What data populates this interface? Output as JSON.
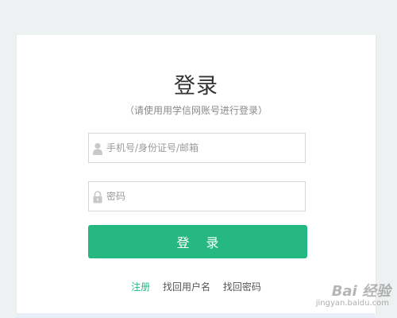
{
  "login": {
    "title": "登录",
    "subtitle": "（请使用用学信网账号进行登录）",
    "username_placeholder": "手机号/身份证号/邮箱",
    "password_placeholder": "密码",
    "submit_label": "登 录",
    "links": {
      "register": "注册",
      "find_username": "找回用户名",
      "find_password": "找回密码"
    }
  },
  "watermark": {
    "main": "Bai 经验",
    "sub": "jingyan.baidu.com"
  },
  "colors": {
    "accent": "#25b883",
    "page_bg": "#eef1f1",
    "card_bg": "#ffffff"
  },
  "icons": {
    "username": "user-icon",
    "password": "lock-icon"
  }
}
